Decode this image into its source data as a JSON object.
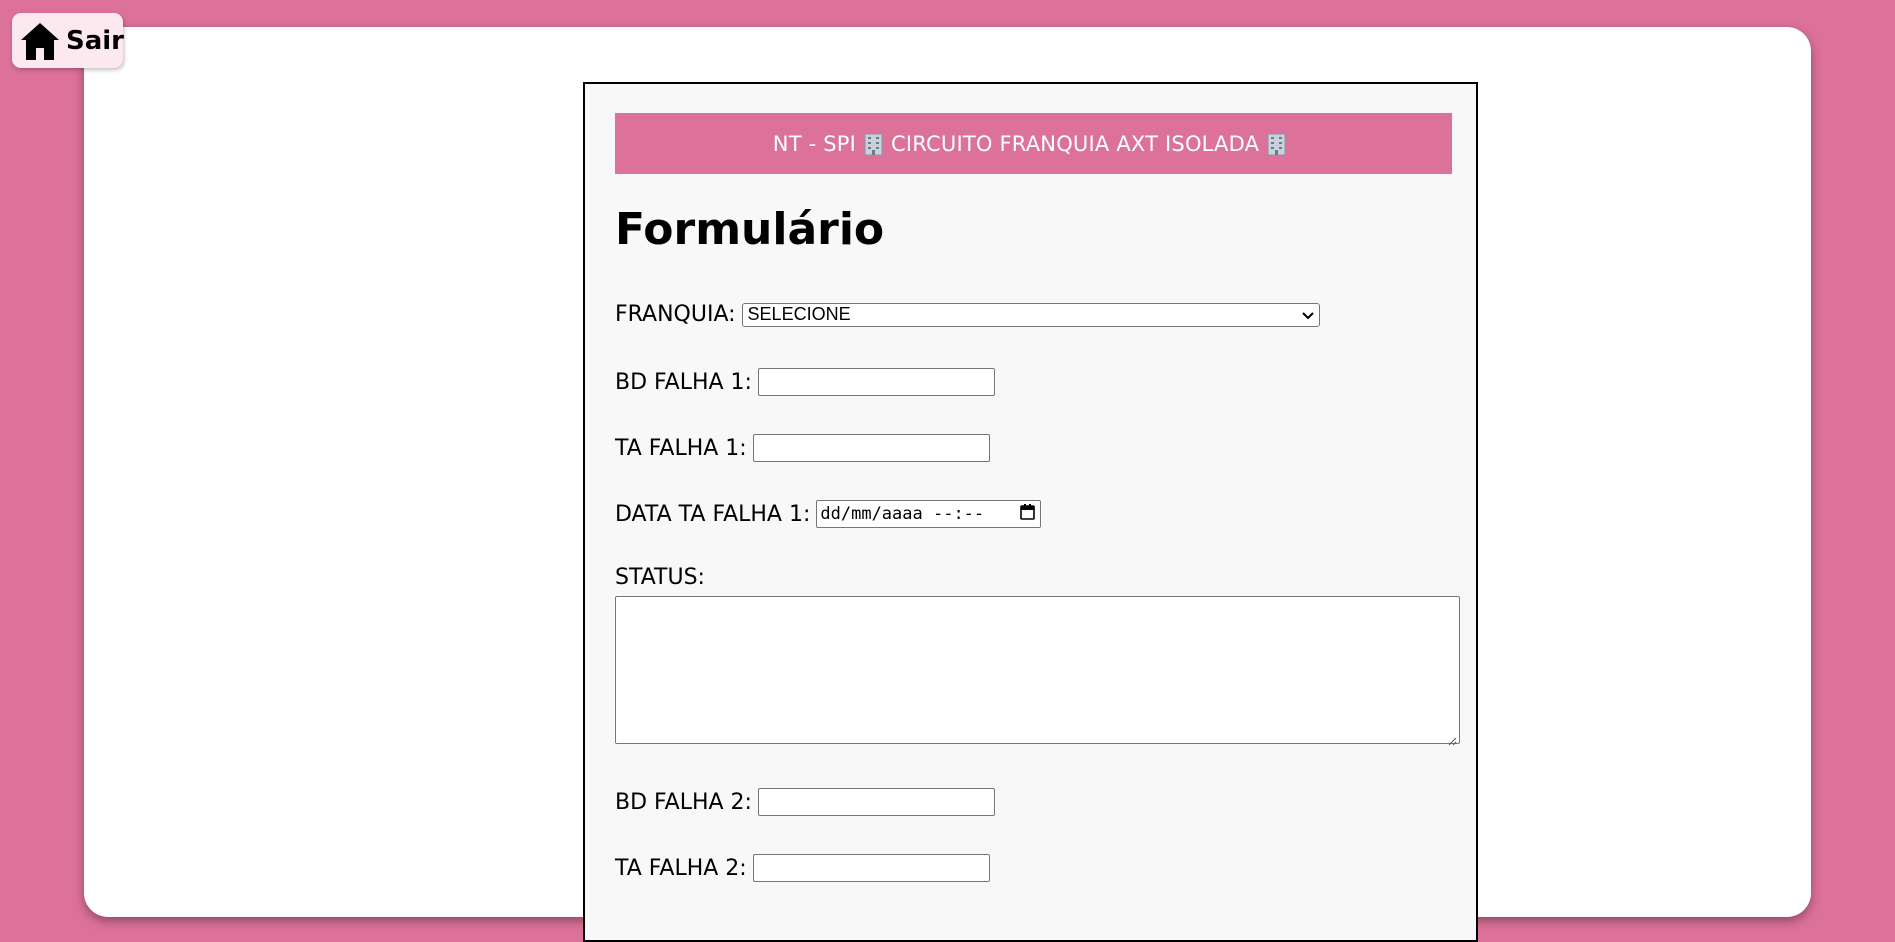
{
  "nav": {
    "exit_label": "Sair",
    "exit_icon": "home-icon"
  },
  "colors": {
    "accent": "#dc7199",
    "card_bg": "#f8f8f8",
    "sheet_bg": "#ffffff"
  },
  "form": {
    "banner_text_left": "NT - SPI",
    "banner_text_middle": "CIRCUITO FRANQUIA AXT ISOLADA",
    "banner_icon": "office-building-icon",
    "title": "Formulário",
    "franquia": {
      "label": "FRANQUIA:",
      "selected": "SELECIONE"
    },
    "bd_falha_1": {
      "label": "BD FALHA 1:",
      "value": ""
    },
    "ta_falha_1": {
      "label": "TA FALHA 1:",
      "value": ""
    },
    "data_ta_falha_1": {
      "label": "DATA TA FALHA 1:",
      "placeholder": "dd/mm/aaaa --:--"
    },
    "status": {
      "label": "STATUS:",
      "value": ""
    },
    "bd_falha_2": {
      "label": "BD FALHA 2:",
      "value": ""
    },
    "ta_falha_2": {
      "label": "TA FALHA 2:",
      "value": ""
    }
  }
}
